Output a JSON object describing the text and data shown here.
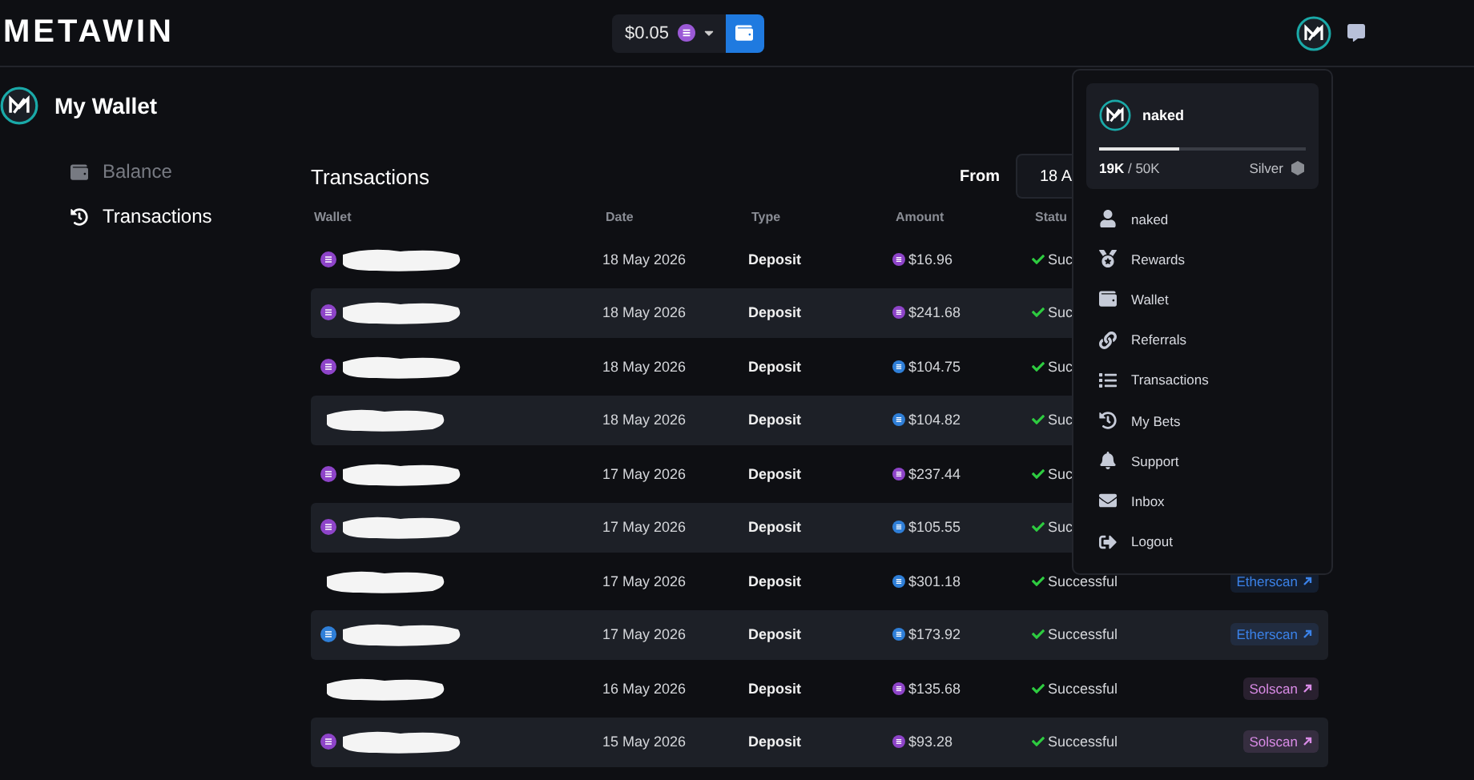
{
  "header": {
    "logo": "METAWIN",
    "balance": "$0.05",
    "balance_coin": {
      "color": "#9b59d6"
    }
  },
  "page": {
    "title": "My Wallet"
  },
  "sidebar": {
    "items": [
      {
        "label": "Balance",
        "selected": false
      },
      {
        "label": "Transactions",
        "selected": true
      }
    ]
  },
  "transactions": {
    "title": "Transactions",
    "from_label": "From",
    "from_value": "18 A",
    "columns": [
      "Wallet",
      "Date",
      "Type",
      "Amount",
      "Statu"
    ],
    "rows": [
      {
        "wallet_coin": {
          "color": "#8e44c9"
        },
        "date": "18 May 2026",
        "type": "Deposit",
        "coin": {
          "color": "#8e44c9"
        },
        "amount": "$16.96",
        "status": "Suc"
      },
      {
        "wallet_coin": {
          "color": "#8e44c9"
        },
        "date": "18 May 2026",
        "type": "Deposit",
        "coin": {
          "color": "#8e44c9"
        },
        "amount": "$241.68",
        "status": "Suc"
      },
      {
        "wallet_coin": {
          "color": "#8e44c9"
        },
        "date": "18 May 2026",
        "type": "Deposit",
        "coin": {
          "color": "#2f7fd8"
        },
        "amount": "$104.75",
        "status": "Suc"
      },
      {
        "date": "18 May 2026",
        "type": "Deposit",
        "coin": {
          "color": "#2f7fd8"
        },
        "amount": "$104.82",
        "status": "Suc"
      },
      {
        "wallet_coin": {
          "color": "#8e44c9"
        },
        "date": "17 May 2026",
        "type": "Deposit",
        "coin": {
          "color": "#8e44c9"
        },
        "amount": "$237.44",
        "status": "Suc"
      },
      {
        "wallet_coin": {
          "color": "#8e44c9"
        },
        "date": "17 May 2026",
        "type": "Deposit",
        "coin": {
          "color": "#2f7fd8"
        },
        "amount": "$105.55",
        "status": "Suc"
      },
      {
        "date": "17 May 2026",
        "type": "Deposit",
        "coin": {
          "color": "#2f7fd8"
        },
        "amount": "$301.18",
        "status": "Successful",
        "link": {
          "label": "Etherscan",
          "color": "#3b82e8"
        }
      },
      {
        "wallet_coin": {
          "color": "#2f7fd8"
        },
        "date": "17 May 2026",
        "type": "Deposit",
        "coin": {
          "color": "#2f7fd8"
        },
        "amount": "$173.92",
        "status": "Successful",
        "link": {
          "label": "Etherscan",
          "color": "#3b82e8"
        }
      },
      {
        "date": "16 May 2026",
        "type": "Deposit",
        "coin": {
          "color": "#8e44c9"
        },
        "amount": "$135.68",
        "status": "Successful",
        "link": {
          "label": "Solscan",
          "color": "#d98be6"
        }
      },
      {
        "wallet_coin": {
          "color": "#8e44c9"
        },
        "date": "15 May 2026",
        "type": "Deposit",
        "coin": {
          "color": "#8e44c9"
        },
        "amount": "$93.28",
        "status": "Successful",
        "link": {
          "label": "Solscan",
          "color": "#d98be6"
        }
      }
    ]
  },
  "user_menu": {
    "username": "naked",
    "level": 0.39,
    "xp": "19K",
    "xp_total": "/ 50K",
    "tier": "Silver",
    "items": [
      {
        "label": "naked"
      },
      {
        "label": "Rewards"
      },
      {
        "label": "Wallet"
      },
      {
        "label": "Referrals"
      },
      {
        "label": "Transactions"
      },
      {
        "label": "My Bets"
      },
      {
        "label": "Support"
      },
      {
        "label": "Inbox"
      },
      {
        "label": "Logout"
      }
    ]
  }
}
